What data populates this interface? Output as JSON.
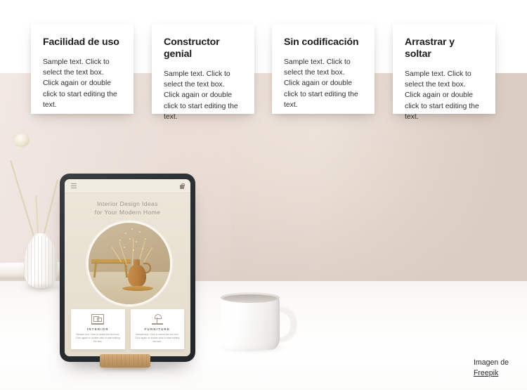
{
  "features": {
    "cards": [
      {
        "title": "Facilidad de uso",
        "text": "Sample text. Click to select the text box. Click again or double click to start editing the text."
      },
      {
        "title": "Constructor genial",
        "text": "Sample text. Click to select the text box. Click again or double click to start editing the text."
      },
      {
        "title": "Sin codificación",
        "text": "Sample text. Click to select the text box. Click again or double click to start editing the text."
      },
      {
        "title": "Arrastrar y soltar",
        "text": "Sample text. Click to select the text box. Click again or double click to start editing the text."
      }
    ]
  },
  "tablet": {
    "nav": {
      "menu_icon": "hamburger-menu-icon",
      "cart_icon": "shopping-bag-icon"
    },
    "headline_line1": "Interior Design Ideas",
    "headline_line2": "for Your Modern Home",
    "hero_image_alt": "dried-flowers-in-terracotta-jug",
    "cards": [
      {
        "icon": "interior-room-icon",
        "title": "INTERIOR",
        "text": "Sample text. Click to select the text box. Click again or double click to start editing the text."
      },
      {
        "icon": "floor-lamp-icon",
        "title": "FURNITURE",
        "text": "Sample text. Click to select the text box. Click again or double click to start editing the text."
      }
    ]
  },
  "scene": {
    "vase_alt": "white-ribbed-vase-with-dried-flowers",
    "mug_alt": "white-ceramic-coffee-mug",
    "stand_alt": "wooden-tablet-stand"
  },
  "credit": {
    "prefix": "Imagen de",
    "link": "Freepik"
  },
  "colors": {
    "card_bg": "#ffffff",
    "page_bg": "#ffffff",
    "wall": "#e8dcd3",
    "wall_light": "#f2e8e4",
    "desk": "#ffffff",
    "tablet_frame": "#2b2f33",
    "screen_bg": "#e8e1d2",
    "accent_wood": "#c39a66",
    "title_text": "#1c1c1c",
    "body_text": "#2e2e2e"
  }
}
